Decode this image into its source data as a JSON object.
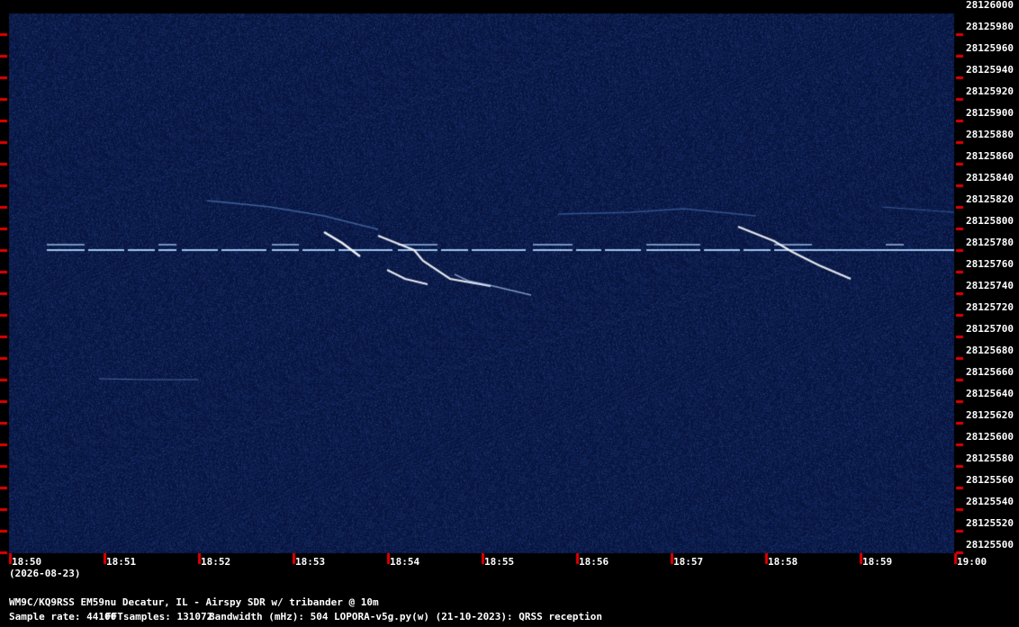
{
  "station": "WM9C/KQ9RSS EM59nu Decatur, IL - Airspy SDR w/ tribander @ 10m",
  "sample_rate": "Sample rate: 44100",
  "fft_samples": "FFTsamples: 131072",
  "bandwidth": "Bandwidth (mHz): 504",
  "software": "LOPORA-v5g.py(w) (21-10-2023): QRSS reception",
  "date": "(2026-08-23)",
  "frequency_labels": [
    "28126000",
    "28125980",
    "28125960",
    "28125940",
    "28125920",
    "28125900",
    "28125880",
    "28125860",
    "28125840",
    "28125820",
    "28125800",
    "28125780",
    "28125760",
    "28125740",
    "28125720",
    "28125700",
    "28125680",
    "28125660",
    "28125640",
    "28125620",
    "28125600",
    "28125580",
    "28125560",
    "28125540",
    "28125520",
    "28125500"
  ],
  "time_labels": [
    "18:50",
    "18:51",
    "18:52",
    "18:53",
    "18:54",
    "18:55",
    "18:56",
    "18:57",
    "18:58",
    "18:59",
    "19:00"
  ],
  "colors": {
    "background": "#000000",
    "waterfall": "#0b1a4a",
    "signal": "#cfe3ff",
    "tick": "#e00000"
  },
  "chart_data": {
    "type": "heatmap",
    "y_range": [
      28125500,
      28126000
    ],
    "x_range": [
      "18:50",
      "19:00"
    ],
    "carrier_frequency": 28125775
  }
}
